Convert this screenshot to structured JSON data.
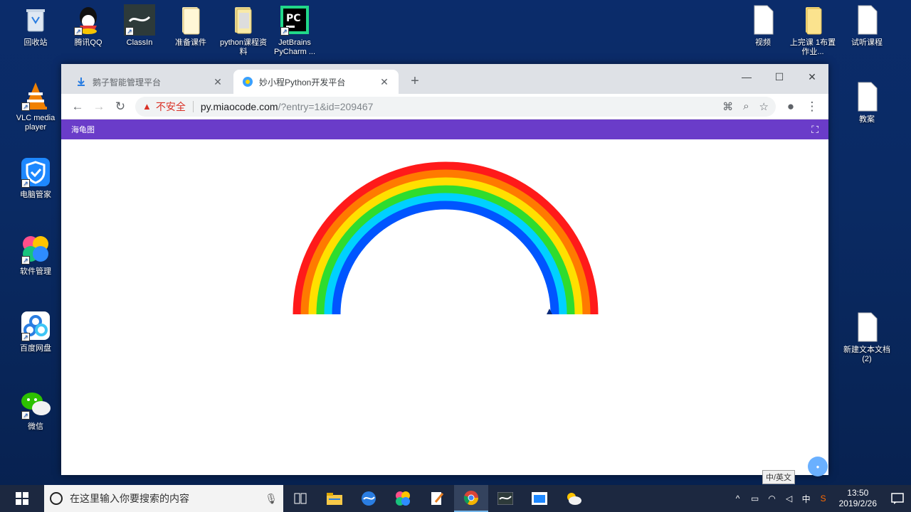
{
  "desktop": {
    "left_icons": [
      {
        "label": "回收站",
        "icon": "recycle-bin-icon"
      },
      {
        "label": "VLC media player",
        "icon": "vlc-icon"
      },
      {
        "label": "电脑管家",
        "icon": "pc-manager-icon"
      },
      {
        "label": "软件管理",
        "icon": "software-manager-icon"
      },
      {
        "label": "百度网盘",
        "icon": "baidu-netdisk-icon"
      },
      {
        "label": "微信",
        "icon": "wechat-icon"
      }
    ],
    "top_icons": [
      {
        "label": "腾讯QQ",
        "icon": "qq-icon"
      },
      {
        "label": "ClassIn",
        "icon": "classin-icon"
      },
      {
        "label": "准备课件",
        "icon": "folder-icon"
      },
      {
        "label": "python课程资料",
        "icon": "folder-icon"
      },
      {
        "label": "JetBrains PyCharm ...",
        "icon": "pycharm-icon"
      }
    ],
    "right_icons": [
      {
        "label": "视频",
        "icon": "document-icon"
      },
      {
        "label": "上完课 1布置作业...",
        "icon": "folder-icon"
      },
      {
        "label": "试听课程",
        "icon": "document-icon"
      },
      {
        "label": "教案",
        "icon": "document-icon"
      },
      {
        "label": "新建文本文档 (2)",
        "icon": "text-file-icon"
      }
    ]
  },
  "browser": {
    "tabs": [
      {
        "title": "鹅子智能管理平台",
        "active": false,
        "icon": "download-icon"
      },
      {
        "title": "妙小程Python开发平台",
        "active": true,
        "icon": "miao-icon"
      }
    ],
    "new_tab_label": "+",
    "window_controls": {
      "minimize": "—",
      "maximize": "☐",
      "close": "✕"
    },
    "address": {
      "security_label": "不安全",
      "host": "py.miaocode.com",
      "path": "/?entry=1&id=209467"
    },
    "app_title": "海龟图"
  },
  "rainbow": {
    "colors": [
      "#ff1a1a",
      "#ff7a00",
      "#ffe000",
      "#2edc2e",
      "#00d1ff",
      "#0055ff"
    ]
  },
  "taskbar": {
    "search_placeholder": "在这里输入你要搜索的内容",
    "ime_popup": "中/英文",
    "tray_ime": "中",
    "time": "13:50",
    "date": "2019/2/26"
  }
}
